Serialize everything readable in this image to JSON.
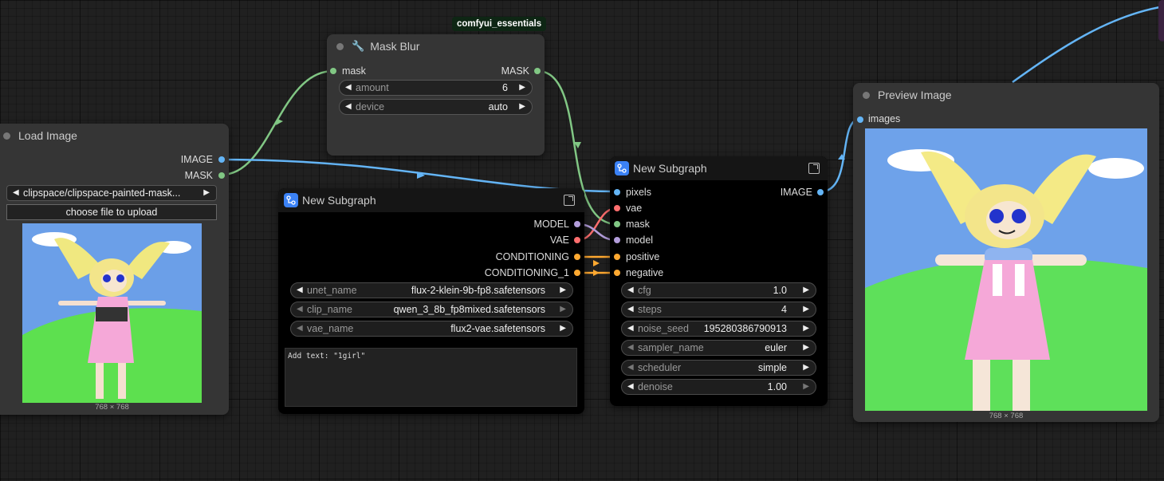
{
  "canvas": {
    "badge": "comfyui_essentials"
  },
  "load_image": {
    "title": "Load Image",
    "outputs": [
      "IMAGE",
      "MASK"
    ],
    "file_combo": "clipspace/clipspace-painted-mask...",
    "upload_button": "choose file to upload",
    "dimensions": "768 × 768"
  },
  "mask_blur": {
    "title": "Mask Blur",
    "input": "mask",
    "output": "MASK",
    "amount_label": "amount",
    "amount_value": "6",
    "device_label": "device",
    "device_value": "auto"
  },
  "subgraph_a": {
    "title": "New Subgraph",
    "outputs": [
      "MODEL",
      "VAE",
      "CONDITIONING",
      "CONDITIONING_1"
    ],
    "widgets": [
      {
        "label": "unet_name",
        "value": "flux-2-klein-9b-fp8.safetensors"
      },
      {
        "label": "clip_name",
        "value": "qwen_3_8b_fp8mixed.safetensors"
      },
      {
        "label": "vae_name",
        "value": "flux2-vae.safetensors"
      }
    ],
    "text": "Add text: \"1girl\""
  },
  "subgraph_b": {
    "title": "New Subgraph",
    "inputs": [
      "pixels",
      "vae",
      "mask",
      "model",
      "positive",
      "negative"
    ],
    "output": "IMAGE",
    "widgets": [
      {
        "label": "cfg",
        "value": "1.0"
      },
      {
        "label": "steps",
        "value": "4"
      },
      {
        "label": "noise_seed",
        "value": "195280386790913"
      },
      {
        "label": "sampler_name",
        "value": "euler"
      },
      {
        "label": "scheduler",
        "value": "simple"
      },
      {
        "label": "denoise",
        "value": "1.00"
      }
    ]
  },
  "preview_image": {
    "title": "Preview Image",
    "input": "images",
    "dimensions": "768 × 768"
  },
  "colors": {
    "image": "#64b5f6",
    "mask": "#81c784",
    "model": "#b39ddb",
    "vae": "#ff6e6e",
    "conditioning": "#ffa931"
  }
}
